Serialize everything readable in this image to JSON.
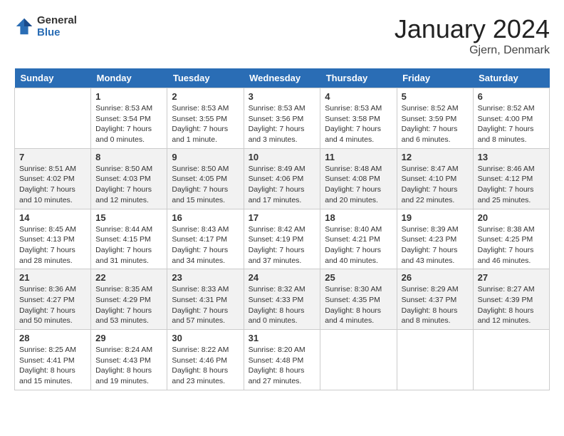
{
  "header": {
    "logo_general": "General",
    "logo_blue": "Blue",
    "month": "January 2024",
    "location": "Gjern, Denmark"
  },
  "weekdays": [
    "Sunday",
    "Monday",
    "Tuesday",
    "Wednesday",
    "Thursday",
    "Friday",
    "Saturday"
  ],
  "weeks": [
    [
      {
        "day": "",
        "info": ""
      },
      {
        "day": "1",
        "info": "Sunrise: 8:53 AM\nSunset: 3:54 PM\nDaylight: 7 hours\nand 0 minutes."
      },
      {
        "day": "2",
        "info": "Sunrise: 8:53 AM\nSunset: 3:55 PM\nDaylight: 7 hours\nand 1 minute."
      },
      {
        "day": "3",
        "info": "Sunrise: 8:53 AM\nSunset: 3:56 PM\nDaylight: 7 hours\nand 3 minutes."
      },
      {
        "day": "4",
        "info": "Sunrise: 8:53 AM\nSunset: 3:58 PM\nDaylight: 7 hours\nand 4 minutes."
      },
      {
        "day": "5",
        "info": "Sunrise: 8:52 AM\nSunset: 3:59 PM\nDaylight: 7 hours\nand 6 minutes."
      },
      {
        "day": "6",
        "info": "Sunrise: 8:52 AM\nSunset: 4:00 PM\nDaylight: 7 hours\nand 8 minutes."
      }
    ],
    [
      {
        "day": "7",
        "info": "Sunrise: 8:51 AM\nSunset: 4:02 PM\nDaylight: 7 hours\nand 10 minutes."
      },
      {
        "day": "8",
        "info": "Sunrise: 8:50 AM\nSunset: 4:03 PM\nDaylight: 7 hours\nand 12 minutes."
      },
      {
        "day": "9",
        "info": "Sunrise: 8:50 AM\nSunset: 4:05 PM\nDaylight: 7 hours\nand 15 minutes."
      },
      {
        "day": "10",
        "info": "Sunrise: 8:49 AM\nSunset: 4:06 PM\nDaylight: 7 hours\nand 17 minutes."
      },
      {
        "day": "11",
        "info": "Sunrise: 8:48 AM\nSunset: 4:08 PM\nDaylight: 7 hours\nand 20 minutes."
      },
      {
        "day": "12",
        "info": "Sunrise: 8:47 AM\nSunset: 4:10 PM\nDaylight: 7 hours\nand 22 minutes."
      },
      {
        "day": "13",
        "info": "Sunrise: 8:46 AM\nSunset: 4:12 PM\nDaylight: 7 hours\nand 25 minutes."
      }
    ],
    [
      {
        "day": "14",
        "info": "Sunrise: 8:45 AM\nSunset: 4:13 PM\nDaylight: 7 hours\nand 28 minutes."
      },
      {
        "day": "15",
        "info": "Sunrise: 8:44 AM\nSunset: 4:15 PM\nDaylight: 7 hours\nand 31 minutes."
      },
      {
        "day": "16",
        "info": "Sunrise: 8:43 AM\nSunset: 4:17 PM\nDaylight: 7 hours\nand 34 minutes."
      },
      {
        "day": "17",
        "info": "Sunrise: 8:42 AM\nSunset: 4:19 PM\nDaylight: 7 hours\nand 37 minutes."
      },
      {
        "day": "18",
        "info": "Sunrise: 8:40 AM\nSunset: 4:21 PM\nDaylight: 7 hours\nand 40 minutes."
      },
      {
        "day": "19",
        "info": "Sunrise: 8:39 AM\nSunset: 4:23 PM\nDaylight: 7 hours\nand 43 minutes."
      },
      {
        "day": "20",
        "info": "Sunrise: 8:38 AM\nSunset: 4:25 PM\nDaylight: 7 hours\nand 46 minutes."
      }
    ],
    [
      {
        "day": "21",
        "info": "Sunrise: 8:36 AM\nSunset: 4:27 PM\nDaylight: 7 hours\nand 50 minutes."
      },
      {
        "day": "22",
        "info": "Sunrise: 8:35 AM\nSunset: 4:29 PM\nDaylight: 7 hours\nand 53 minutes."
      },
      {
        "day": "23",
        "info": "Sunrise: 8:33 AM\nSunset: 4:31 PM\nDaylight: 7 hours\nand 57 minutes."
      },
      {
        "day": "24",
        "info": "Sunrise: 8:32 AM\nSunset: 4:33 PM\nDaylight: 8 hours\nand 0 minutes."
      },
      {
        "day": "25",
        "info": "Sunrise: 8:30 AM\nSunset: 4:35 PM\nDaylight: 8 hours\nand 4 minutes."
      },
      {
        "day": "26",
        "info": "Sunrise: 8:29 AM\nSunset: 4:37 PM\nDaylight: 8 hours\nand 8 minutes."
      },
      {
        "day": "27",
        "info": "Sunrise: 8:27 AM\nSunset: 4:39 PM\nDaylight: 8 hours\nand 12 minutes."
      }
    ],
    [
      {
        "day": "28",
        "info": "Sunrise: 8:25 AM\nSunset: 4:41 PM\nDaylight: 8 hours\nand 15 minutes."
      },
      {
        "day": "29",
        "info": "Sunrise: 8:24 AM\nSunset: 4:43 PM\nDaylight: 8 hours\nand 19 minutes."
      },
      {
        "day": "30",
        "info": "Sunrise: 8:22 AM\nSunset: 4:46 PM\nDaylight: 8 hours\nand 23 minutes."
      },
      {
        "day": "31",
        "info": "Sunrise: 8:20 AM\nSunset: 4:48 PM\nDaylight: 8 hours\nand 27 minutes."
      },
      {
        "day": "",
        "info": ""
      },
      {
        "day": "",
        "info": ""
      },
      {
        "day": "",
        "info": ""
      }
    ]
  ]
}
